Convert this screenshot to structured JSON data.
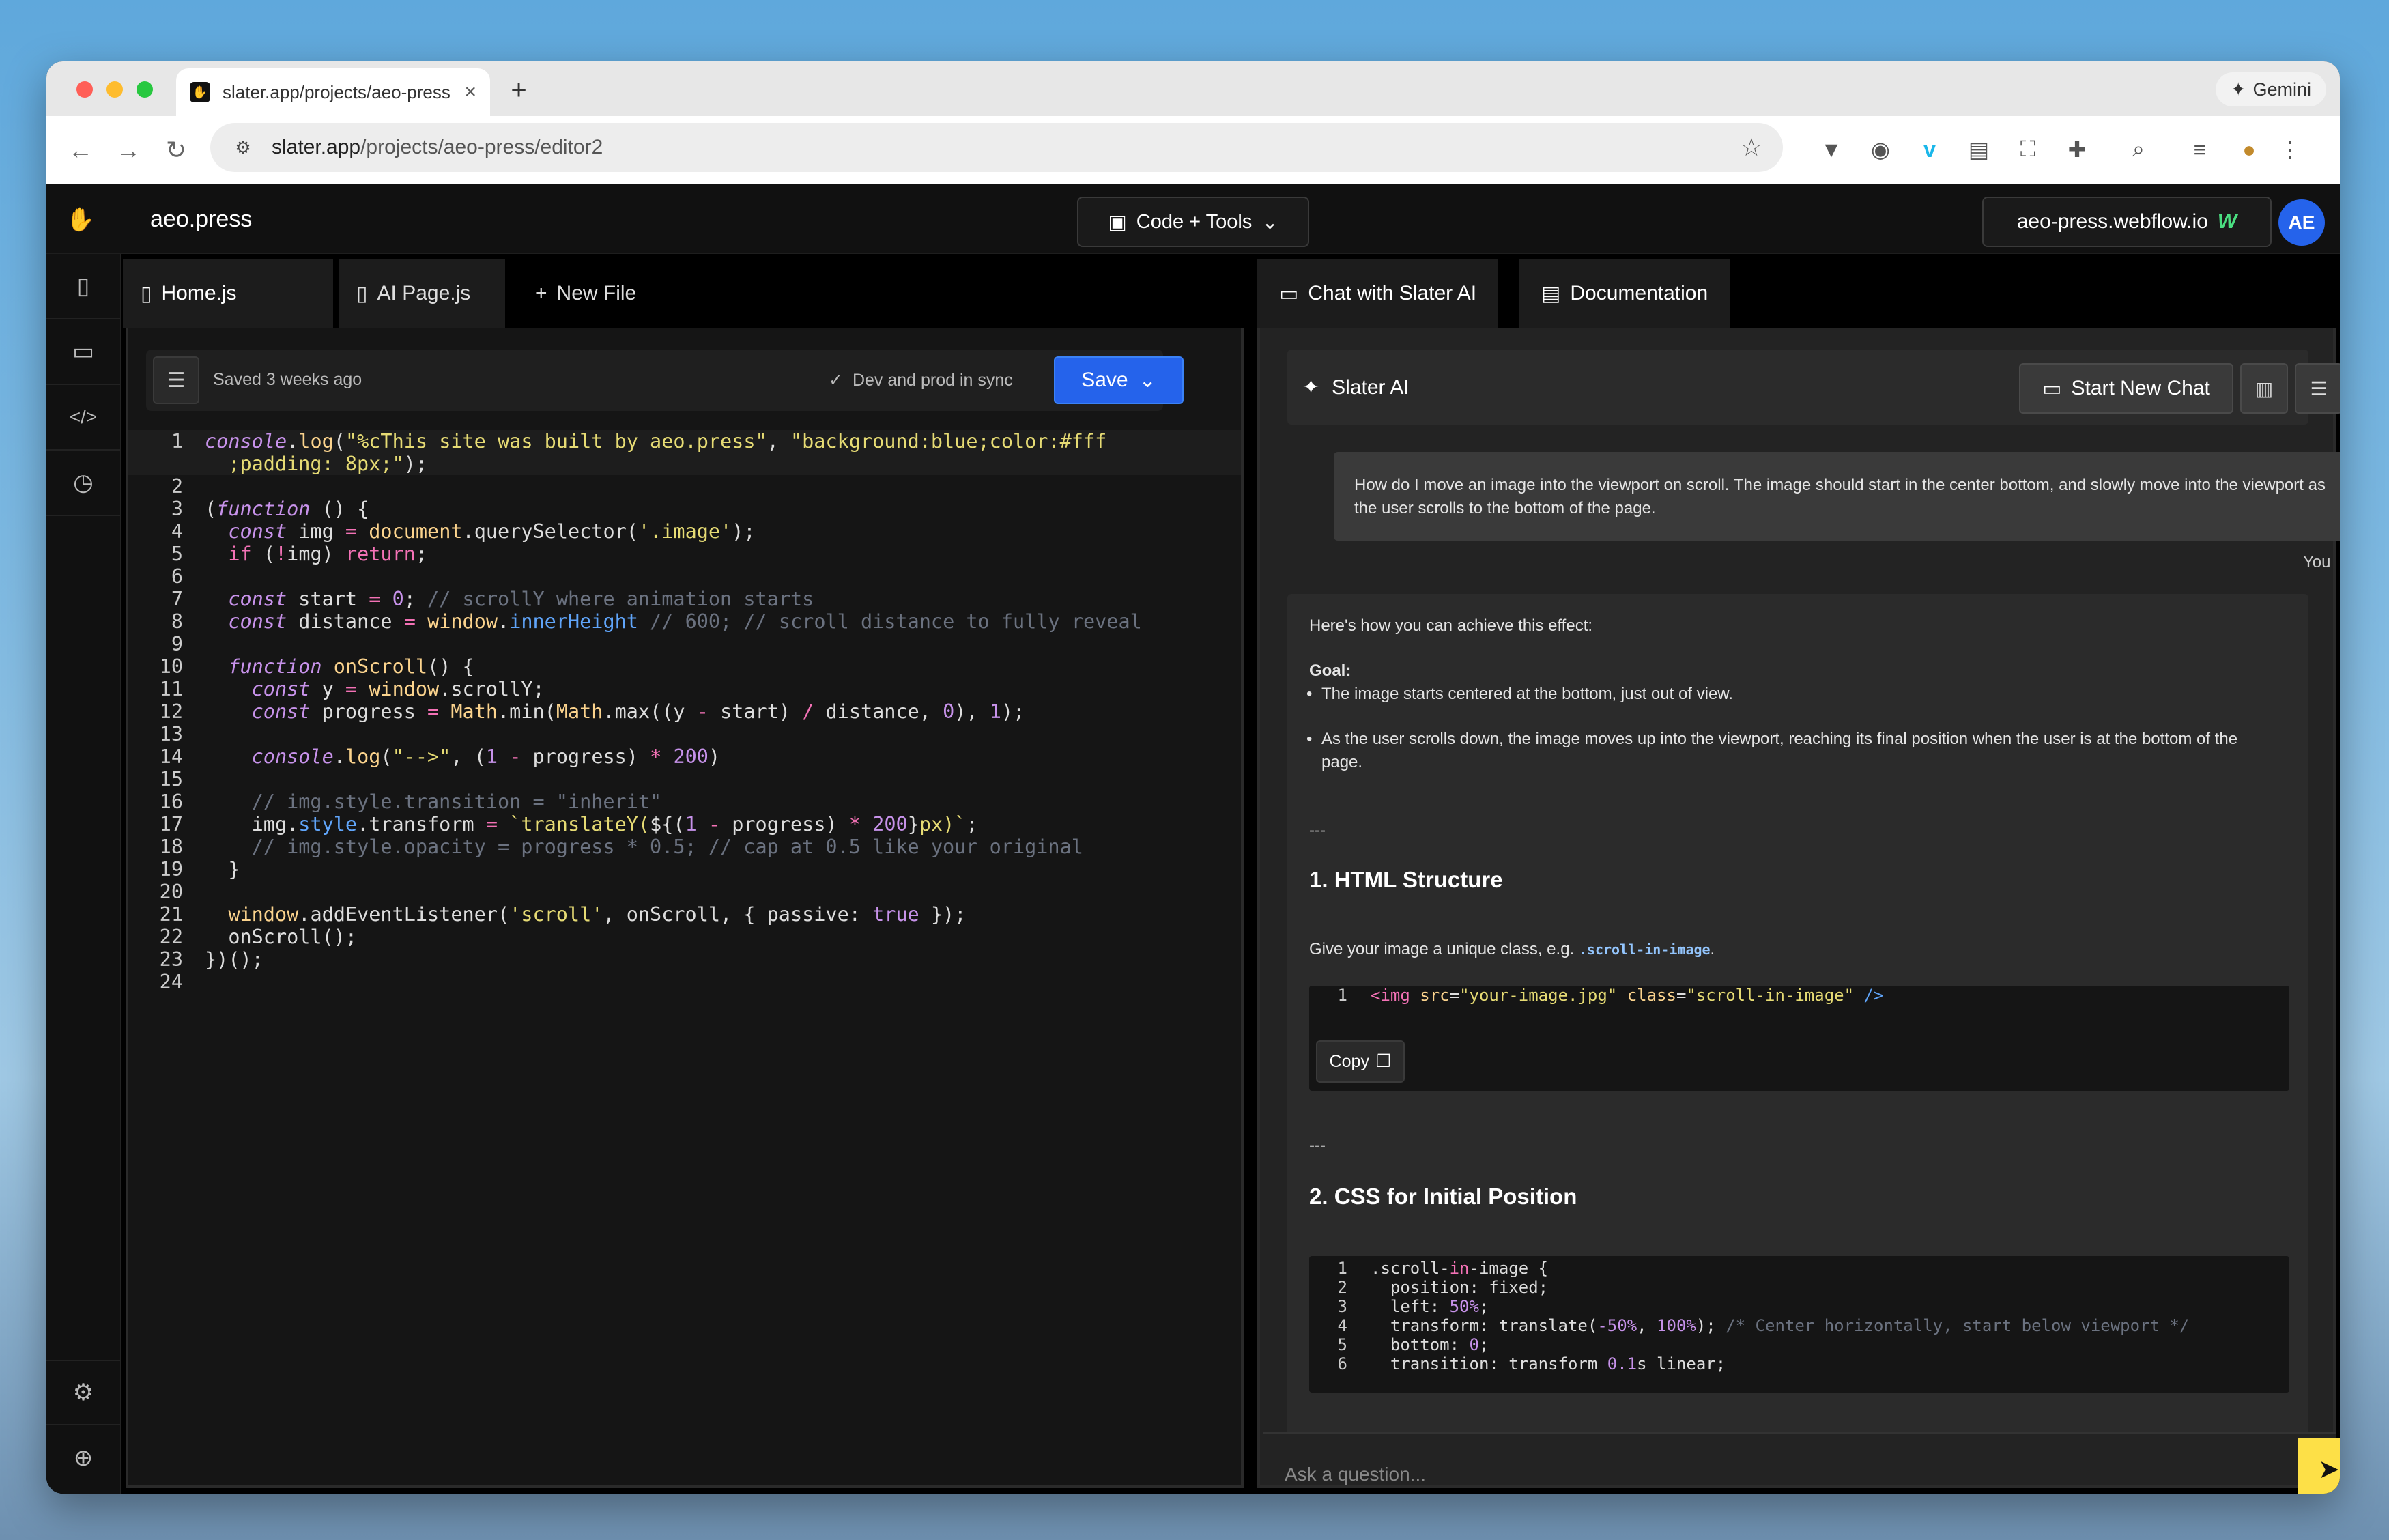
{
  "browser": {
    "tab_title": "slater.app/projects/aeo-press",
    "url_domain": "slater.app",
    "url_path": "/projects/aeo-press/editor2",
    "gemini_label": "Gemini"
  },
  "app": {
    "name": "aeo.press",
    "mode_label": "Code + Tools",
    "site_label": "aeo-press.webflow.io",
    "avatar": "AE"
  },
  "editor": {
    "tabs": [
      "Home.js",
      "AI Page.js",
      "New File"
    ],
    "saved_text": "Saved 3 weeks ago",
    "sync_text": "Dev and prod in sync",
    "save_label": "Save"
  },
  "chat": {
    "tabs": [
      "Chat with Slater AI",
      "Documentation"
    ],
    "title": "Slater AI",
    "new_chat_label": "Start New Chat",
    "user_message": "How do I move an image into the viewport on scroll. The image should start in the center bottom, and slowly move into the viewport as the user scrolls to the bottom of the page.",
    "user_label": "You",
    "reply_intro": "Here's how you can achieve this effect:",
    "goal_label": "Goal:",
    "goal_bullets": [
      "The image starts centered at the bottom, just out of view.",
      "As the user scrolls down, the image moves up into the viewport, reaching its final position when the user is at the bottom of the page."
    ],
    "separator": "---",
    "section1_title": "1. HTML Structure",
    "section1_text": "Give your image a unique class, e.g.",
    "section1_code_inline": ".scroll-in-image",
    "section1_dot": ".",
    "copy_label": "Copy",
    "section2_title": "2. CSS for Initial Position",
    "ask_placeholder": "Ask a question..."
  },
  "icons": {
    "logo": "hand-icon",
    "send": "send-icon"
  }
}
